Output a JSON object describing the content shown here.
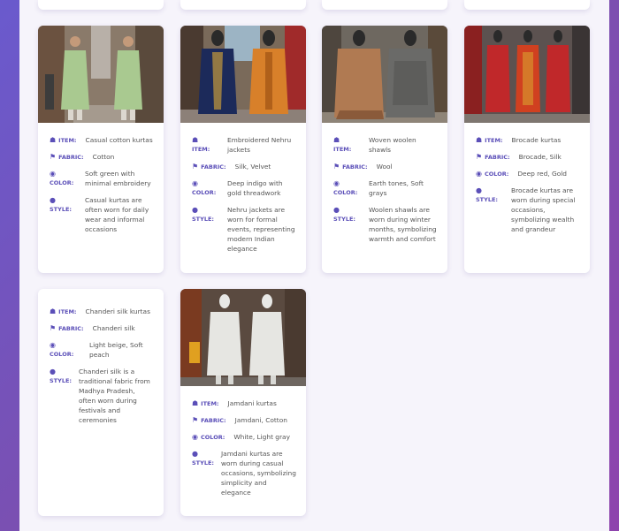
{
  "labels": {
    "item": "ITEM:",
    "fabric": "FABRIC:",
    "color": "COLOR:",
    "style": "STYLE:"
  },
  "icons": {
    "item": "tshirt-icon",
    "fabric": "fabric-icon",
    "color": "palette-icon",
    "style": "circle-icon"
  },
  "cards": [
    {
      "item": "Casual cotton kurtas",
      "fabric": "Cotton",
      "color": "Soft green with minimal embroidery",
      "style": "Casual kurtas are often worn for daily wear and informal occasions"
    },
    {
      "item": "Embroidered Nehru jackets",
      "fabric": "Silk, Velvet",
      "color": "Deep indigo with gold threadwork",
      "style": "Nehru jackets are worn for formal events, representing modern Indian elegance"
    },
    {
      "item": "Woven woolen shawls",
      "fabric": "Wool",
      "color": "Earth tones, Soft grays",
      "style": "Woolen shawls are worn during winter months, symbolizing warmth and comfort"
    },
    {
      "item": "Brocade kurtas",
      "fabric": "Brocade, Silk",
      "color": "Deep red, Gold",
      "style": "Brocade kurtas are worn during special occasions, symbolizing wealth and grandeur"
    },
    {
      "item": "Chanderi silk kurtas",
      "fabric": "Chanderi silk",
      "color": "Light beige, Soft peach",
      "style": "Chanderi silk is a traditional fabric from Madhya Pradesh, often worn during festivals and ceremonies"
    },
    {
      "item": "Jamdani kurtas",
      "fabric": "Jamdani, Cotton",
      "color": "White, Light gray",
      "style": "Jamdani kurtas are worn during casual occasions, symbolizing simplicity and elegance"
    }
  ]
}
